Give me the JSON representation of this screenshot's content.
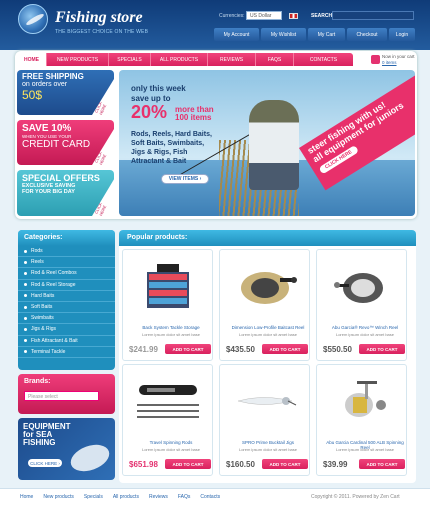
{
  "header": {
    "logo": "Fishing store",
    "tagline": "THE BIGGEST CHOICE ON THE WEB",
    "currencies_label": "Currencies:",
    "currency_value": "US Dollar",
    "search_label": "SEARCH:",
    "account_links": [
      "My Account",
      "My Wishlist",
      "My Cart",
      "Checkout",
      "Login"
    ]
  },
  "nav": {
    "items": [
      "HOME",
      "NEW PRODUCTS",
      "SPECIALS",
      "ALL PRODUCTS",
      "REVIEWS",
      "FAQS",
      "CONTACTS"
    ]
  },
  "cart": {
    "line1": "Now in your cart",
    "line2": "0 items"
  },
  "promos": [
    {
      "line1": "FREE SHIPPING",
      "line2": "on orders over",
      "line3": "50$",
      "corner": "CLICK HERE"
    },
    {
      "line1": "SAVE 10%",
      "line2": "WHEN YOU USE YOUR",
      "line3": "CREDIT CARD",
      "corner": "CLICK HERE"
    },
    {
      "line1": "SPECIAL OFFERS",
      "line2": "EXCLUSIVE SAVING",
      "line3": "FOR YOUR BIG DAY",
      "corner": "CLICK HERE"
    }
  ],
  "banner": {
    "line1": "only this week",
    "line2": "save up to",
    "pct": "20%",
    "line3": "more than",
    "line4": "100 items",
    "list": [
      "Rods, Reels, Hard Baits,",
      "Soft Baits, Swimbaits,",
      "Jigs & Rigs, Fish",
      "Attractant & Bait"
    ],
    "button": "VIEW ITEMS ›",
    "rib1": "steer fishing with us!",
    "rib2": "all equipment for juniors",
    "rib_btn": "CLICK HERE"
  },
  "categories": {
    "title": "Categories:",
    "items": [
      "Rods",
      "Reels",
      "Rod & Reel Combos",
      "Rod & Reel Storage",
      "Hard Baits",
      "Soft Baits",
      "Swimbaits",
      "Jigs & Rigs",
      "Fish Attractant & Bait",
      "Terminal Tackle"
    ]
  },
  "brands": {
    "title": "Brands:",
    "placeholder": "Please select"
  },
  "equipment": {
    "line1": "EQUIPMENT",
    "line2": "for SEA",
    "line3": "FISHING",
    "button": "CLICK HERE ›"
  },
  "popular": {
    "title": "Popular products:",
    "add_label": "ADD TO CART",
    "products": [
      {
        "name": "Back System Tackle Storage",
        "desc": "Lorem ipsum dolor sit amet base",
        "price": "$241.99",
        "price_color": "#999999"
      },
      {
        "name": "Dimension Low-Profile Baitcast Reel",
        "desc": "Lorem ipsum dolor sit amet base",
        "price": "$435.50",
        "price_color": "#555555"
      },
      {
        "name": "Abu Garcia® Revo™ Winch Reel",
        "desc": "Lorem ipsum dolor sit amet base",
        "price": "$550.50",
        "price_color": "#555555"
      },
      {
        "name": "Travel Spinning Rods",
        "desc": "Lorem ipsum dolor sit amet base",
        "price": "$651.98",
        "price_color": "#e43270"
      },
      {
        "name": "SPRO Prime Bucktail Jigs",
        "desc": "Lorem ipsum dolor sit amet base",
        "price": "$160.50",
        "price_color": "#555555"
      },
      {
        "name": "Abu Garcia Cardinal 500 ALB Spinning Reel",
        "desc": "Lorem ipsum dolor sit amet base",
        "price": "$39.99",
        "price_color": "#555555"
      }
    ]
  },
  "footer": {
    "links": [
      "Home",
      "New products",
      "Specials",
      "All products",
      "Reviews",
      "FAQs",
      "Contacts"
    ],
    "copyright": "Copyright © 2011. Powered by Zen Cart"
  }
}
